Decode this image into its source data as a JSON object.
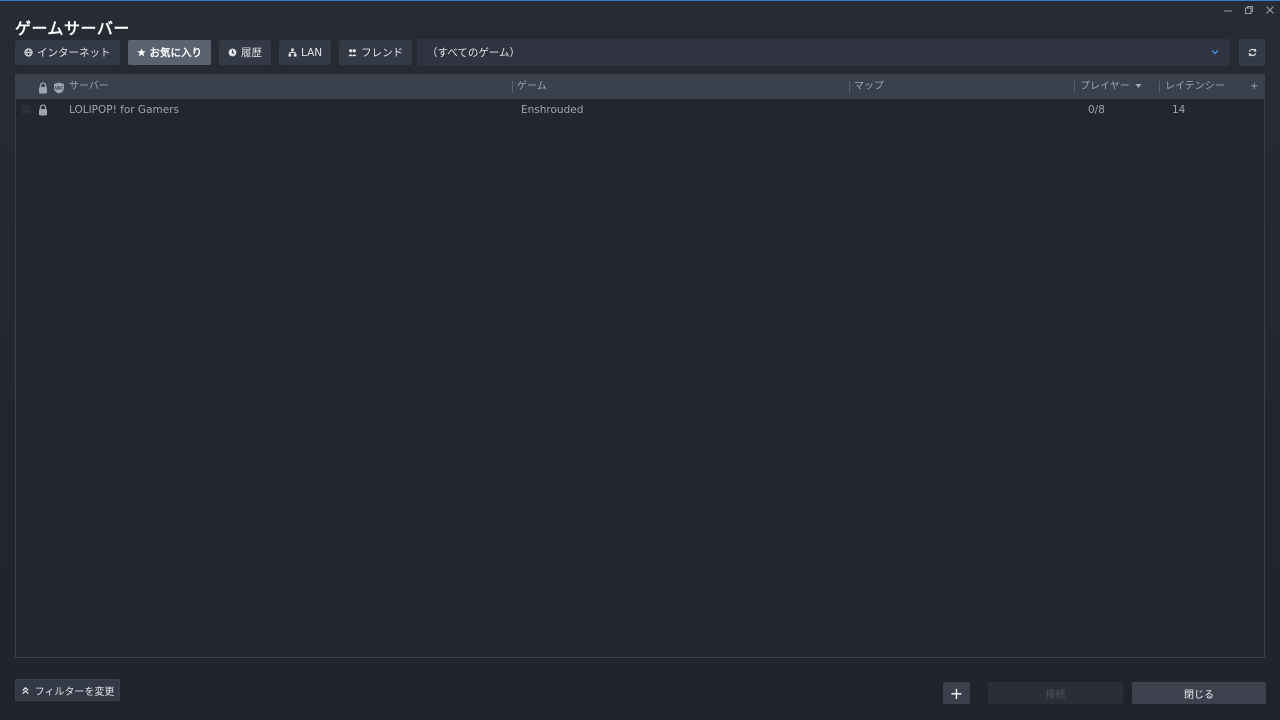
{
  "window": {
    "title": "ゲームサーバー",
    "controls": [
      "minimize-icon",
      "restore-icon",
      "close-icon"
    ]
  },
  "tabs": [
    {
      "label": "インターネット",
      "icon": "globe-icon",
      "active": false
    },
    {
      "label": "お気に入り",
      "icon": "star-icon",
      "active": true
    },
    {
      "label": "履歴",
      "icon": "clock-icon",
      "active": false
    },
    {
      "label": "LAN",
      "icon": "network-icon",
      "active": false
    },
    {
      "label": "フレンド",
      "icon": "friends-icon",
      "active": false
    }
  ],
  "game_filter": {
    "selected": "（すべてのゲーム）"
  },
  "columns": {
    "server": "サーバー",
    "game": "ゲーム",
    "map": "マップ",
    "players": "プレイヤー",
    "latency": "レイテンシー",
    "add": "+"
  },
  "servers": [
    {
      "name": "LOLIPOP! for Gamers",
      "game": "Enshrouded",
      "map": "",
      "players": "0/8",
      "latency": "14",
      "locked": true
    }
  ],
  "footer": {
    "filter_label": "フィルターを変更",
    "add_label": "+",
    "connect_label": "接続",
    "close_label": "閉じる"
  },
  "colors": {
    "accent": "#3a7bbf",
    "background": "#1f232b",
    "active_tab": "#5b6270"
  }
}
